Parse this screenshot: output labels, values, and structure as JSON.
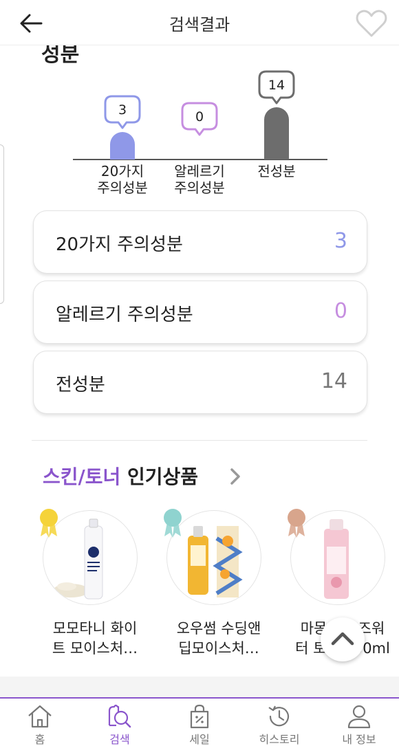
{
  "header": {
    "title": "검색결과",
    "back_icon": "arrow-left-icon",
    "favorite_icon": "heart-outline-icon"
  },
  "section": {
    "heading": "성분"
  },
  "chart_data": {
    "type": "bar",
    "categories": [
      "20가지 주의성분",
      "알레르기 주의성분",
      "전성분"
    ],
    "category_lines": [
      [
        "20가지",
        "주의성분"
      ],
      [
        "알레르기",
        "주의성분"
      ],
      [
        "전성분"
      ]
    ],
    "values": [
      3,
      0,
      14
    ],
    "colors": [
      "#8f98e8",
      "#c68ee0",
      "#6d6d6d"
    ],
    "ylim": [
      0,
      14
    ]
  },
  "summary": [
    {
      "label": "20가지 주의성분",
      "count": "3",
      "color": "#8f98e8"
    },
    {
      "label": "알레르기 주의성분",
      "count": "0",
      "color": "#c68ee0"
    },
    {
      "label": "전성분",
      "count": "14",
      "color": "#777777"
    }
  ],
  "popular": {
    "accent": "스킨/토너",
    "title_rest": " 인기상품",
    "arrow_icon": "chevron-right-icon",
    "products": [
      {
        "name_line1": "모모타니 화이",
        "name_line2": "트 모이스처…",
        "medal": "gold",
        "medal_color": "#f5d33a"
      },
      {
        "name_line1": "오우썸 수딩앤",
        "name_line2": "딥모이스처…",
        "medal": "silver",
        "medal_color": "#8fd3cf"
      },
      {
        "name_line1": "마몽드 로즈워",
        "name_line2": "터 토너 250ml",
        "medal": "bronze",
        "medal_color": "#d8a58c"
      }
    ]
  },
  "scroll_top_icon": "chevron-up-icon",
  "nav": [
    {
      "label": "홈",
      "icon": "home-icon"
    },
    {
      "label": "검색",
      "icon": "search-icon",
      "active": true
    },
    {
      "label": "세일",
      "icon": "sale-bag-icon"
    },
    {
      "label": "히스토리",
      "icon": "history-icon"
    },
    {
      "label": "내 정보",
      "icon": "user-icon"
    }
  ],
  "colors": {
    "brand": "#8a55cc"
  }
}
